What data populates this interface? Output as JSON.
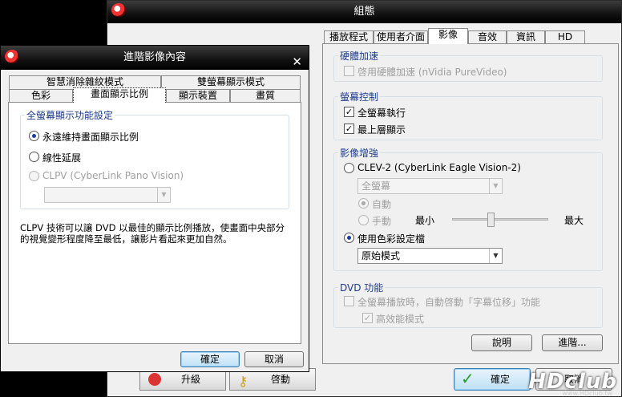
{
  "config_dialog": {
    "title": "組態",
    "tabs": [
      "播放程式",
      "使用者介面",
      "影像",
      "音效",
      "資訊",
      "HD DVD"
    ],
    "active_tab": "影像",
    "hw_accel": {
      "legend": "硬體加速",
      "enable_label": "啓用硬體加速 (nVidia PureVideo)"
    },
    "screen_control": {
      "legend": "螢幕控制",
      "fullscreen_label": "全螢幕執行",
      "on_top_label": "最上層顯示"
    },
    "enhance": {
      "legend": "影像增強",
      "clev_label": "CLEV-2 (CyberLink Eagle Vision-2)",
      "clev_mode_value": "全螢幕",
      "auto_label": "自動",
      "manual_label": "手動",
      "min_label": "最小",
      "max_label": "最大",
      "slider_level": 0.4,
      "color_profile_label": "使用色彩設定檔",
      "color_profile_value": "原始模式"
    },
    "dvd": {
      "legend": "DVD 功能",
      "subtitle_shift_label": "全螢幕播放時，自動啓動「字幕位移」功能",
      "high_perf_label": "高效能模式"
    },
    "explain_button": "說明",
    "advanced_button": "進階...",
    "ok_button": "確定",
    "cancel_button": "取消"
  },
  "advanced_dialog": {
    "title": "進階影像內容",
    "tabs_row1": [
      "智慧消除雜紋模式",
      "雙螢幕顯示模式"
    ],
    "tabs_row2": [
      "色彩",
      "畫面顯示比例",
      "顯示裝置",
      "畫質"
    ],
    "active_tab": "畫面顯示比例",
    "group_legend": "全螢幕顯示功能設定",
    "opt_keep_ratio": "永遠維持畫面顯示比例",
    "opt_linear": "線性延展",
    "opt_clpv": "CLPV (CyberLink Pano Vision)",
    "description": "CLPV 技術可以讓 DVD 以最佳的顯示比例播放，使畫面中央部分的視覺變形程度降至最低，讓影片看起來更加自然。",
    "ok_button": "確定",
    "cancel_button": "取消"
  },
  "background": {
    "upgrade_button": "升級",
    "activate_button": "啓動"
  },
  "watermark": {
    "logo": "HDclub",
    "url": "www.HDclub.tw"
  },
  "colors": {
    "legend_blue": "#1e3c8c",
    "disabled_gray": "#a0a0a0"
  }
}
